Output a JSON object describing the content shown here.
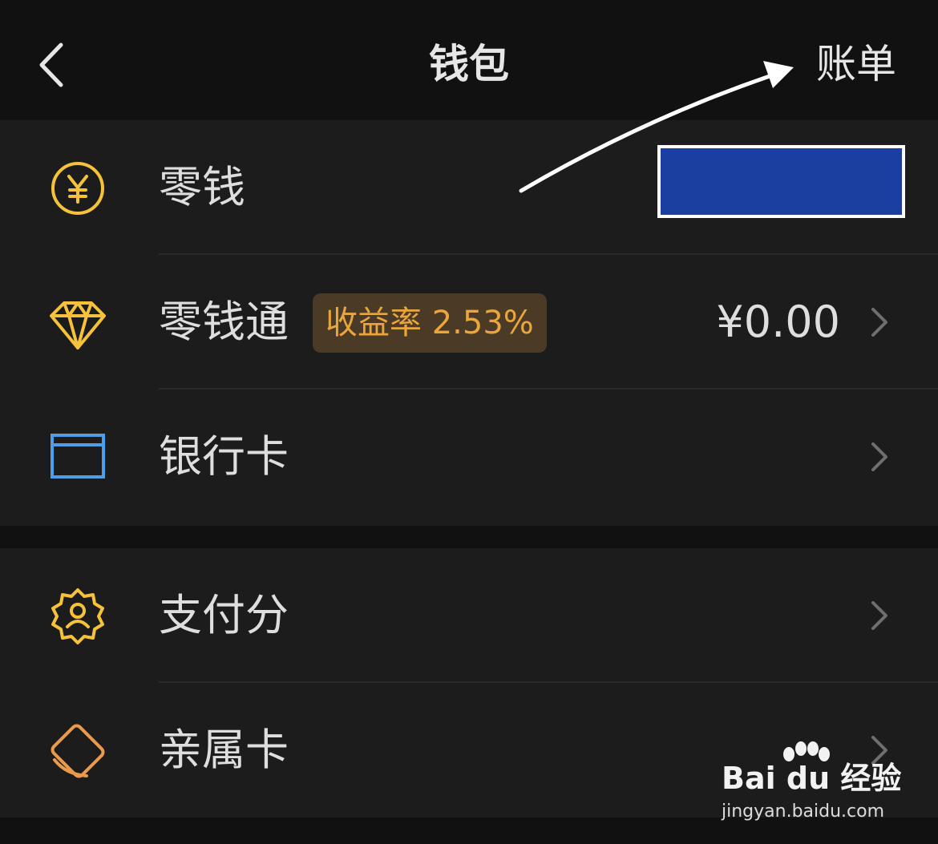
{
  "navbar": {
    "title": "钱包",
    "right_label": "账单"
  },
  "wallet": {
    "items": [
      {
        "label": "零钱",
        "icon": "yuan-coin-icon"
      },
      {
        "label": "零钱通",
        "badge": "收益率 2.53%",
        "amount": "¥0.00",
        "icon": "diamond-icon"
      },
      {
        "label": "银行卡",
        "icon": "bank-card-icon"
      }
    ]
  },
  "services": {
    "items": [
      {
        "label": "支付分",
        "icon": "credit-score-badge-icon"
      },
      {
        "label": "亲属卡",
        "icon": "family-card-icon"
      }
    ]
  },
  "watermark": {
    "brand": "Bai du 经验",
    "url": "jingyan.baidu.com"
  },
  "colors": {
    "background": "#111111",
    "row": "#1c1c1c",
    "text": "#dedede",
    "gold": "#f5c23a",
    "blue_icon": "#4a9fe8",
    "orange_icon": "#e99a4a",
    "badge_bg": "#4a3a26",
    "badge_text": "#eaa63a",
    "redaction": "#1a3fa0"
  }
}
